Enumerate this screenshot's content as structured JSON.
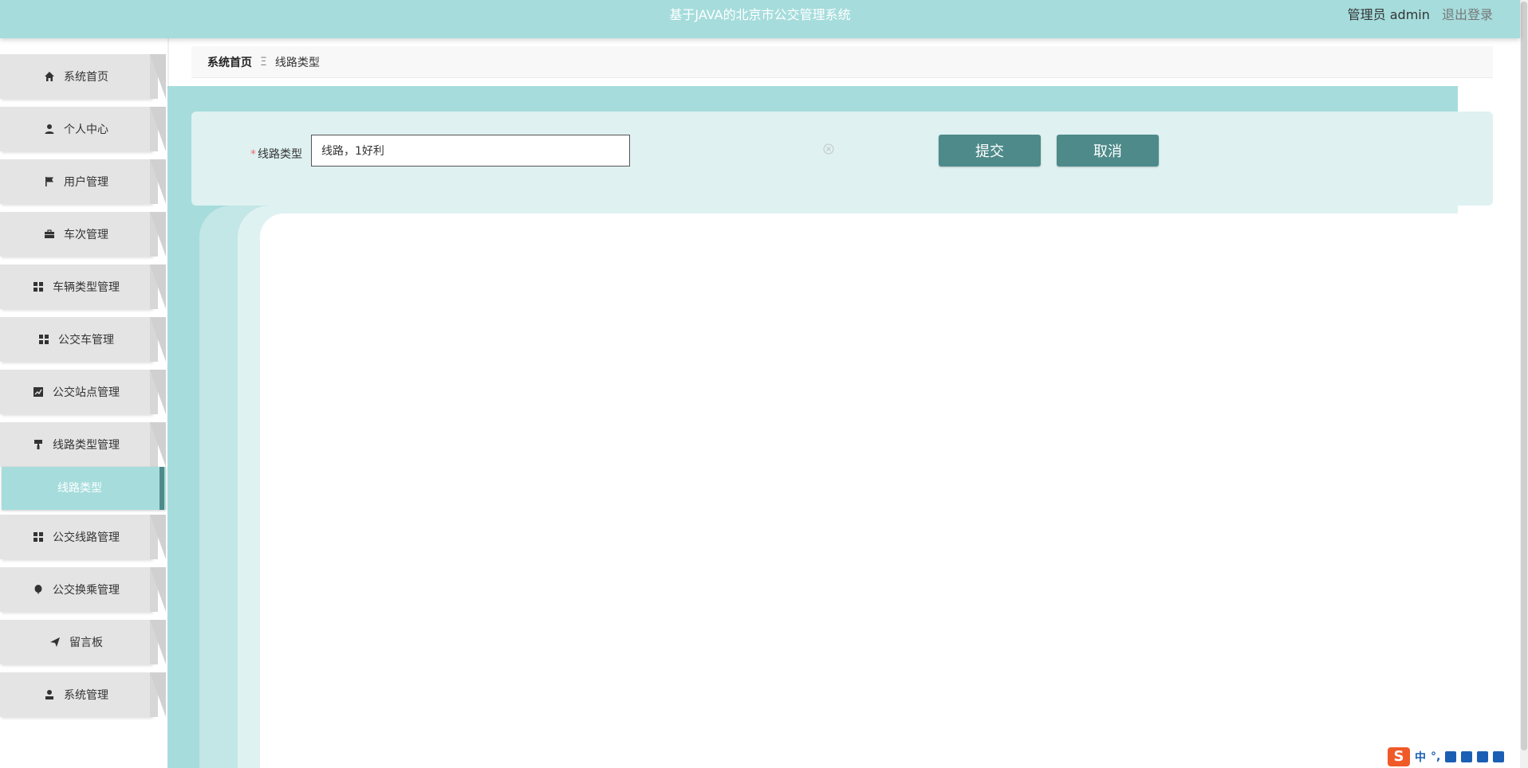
{
  "header": {
    "title": "基于JAVA的北京市公交管理系统",
    "user_label": "管理员 admin",
    "logout_label": "退出登录"
  },
  "sidebar": {
    "items": [
      {
        "label": "系统首页",
        "icon": "home-icon"
      },
      {
        "label": "个人中心",
        "icon": "person-icon"
      },
      {
        "label": "用户管理",
        "icon": "flag-icon"
      },
      {
        "label": "车次管理",
        "icon": "briefcase-icon"
      },
      {
        "label": "车辆类型管理",
        "icon": "grid-icon"
      },
      {
        "label": "公交车管理",
        "icon": "grid-icon"
      },
      {
        "label": "公交站点管理",
        "icon": "chart-icon"
      },
      {
        "label": "线路类型管理",
        "icon": "paint-roller-icon"
      },
      {
        "label": "公交线路管理",
        "icon": "grid-icon"
      },
      {
        "label": "公交换乘管理",
        "icon": "balloon-icon"
      },
      {
        "label": "留言板",
        "icon": "paper-plane-icon"
      },
      {
        "label": "系统管理",
        "icon": "user-icon"
      }
    ],
    "active_sub_item": "线路类型"
  },
  "breadcrumb": {
    "home": "系统首页",
    "separator": "Ξ",
    "current": "线路类型"
  },
  "form": {
    "field_label": "线路类型",
    "field_value": "线路，1好利",
    "submit_label": "提交",
    "cancel_label": "取消"
  },
  "ime": {
    "logo": "S",
    "mode": "中"
  },
  "colors": {
    "header_bg": "#a6dcdc",
    "button_bg": "#4e8a8a",
    "menu_bg": "#e4e4e4",
    "card_bg": "#dff1f1"
  }
}
